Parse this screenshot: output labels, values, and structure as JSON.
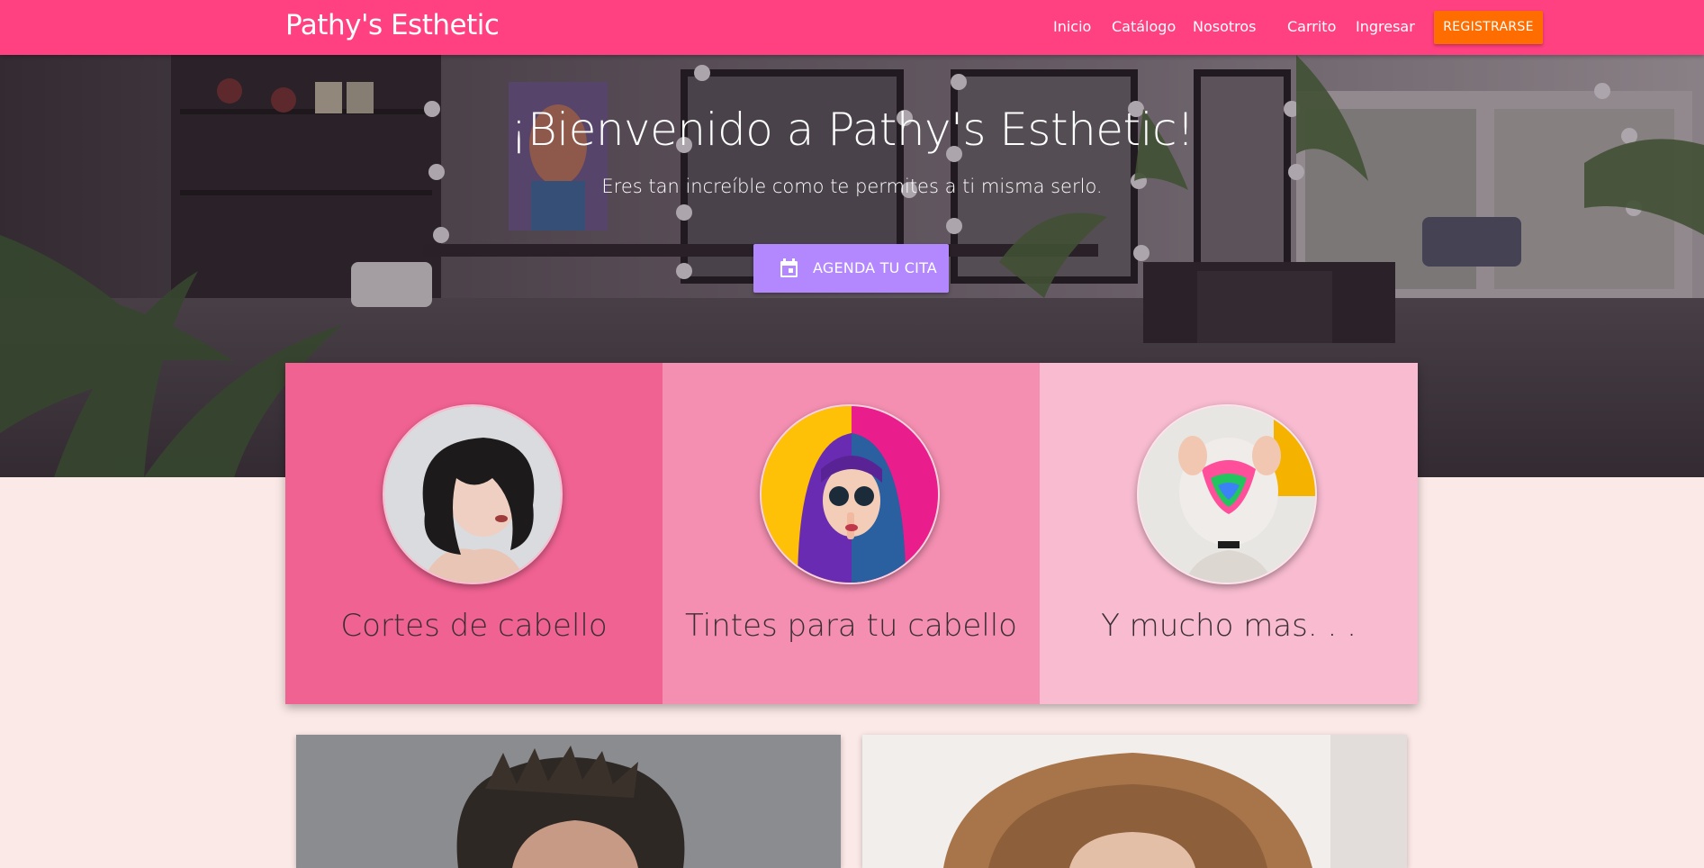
{
  "navbar": {
    "brand": "Pathy's Esthetic",
    "links": [
      "Inicio",
      "Catálogo",
      "Nosotros",
      "Carrito",
      "Ingresar"
    ],
    "register_label": "REGISTRARSE"
  },
  "hero": {
    "title": "¡Bienvenido a Pathy's Esthetic!",
    "subtitle": "Eres tan increíble como te permites a ti misma serlo.",
    "cta_label": "AGENDA TU CITA",
    "cta_icon": "calendar-icon"
  },
  "features": [
    {
      "label": "Cortes de cabello",
      "image": "woman-short-black-hair"
    },
    {
      "label": "Tintes para tu cabello",
      "image": "woman-purple-blue-hair"
    },
    {
      "label": "Y mucho mas. . .",
      "image": "rainbow-dyed-hair"
    }
  ],
  "colors": {
    "navbar": "#ff4081",
    "register_button": "#ff6d00",
    "cta_button": "#b388ff",
    "feature_1": "#f06292",
    "feature_2": "#f48fb1",
    "feature_3": "#f8bbd0",
    "page_background": "#fbe9e7"
  }
}
